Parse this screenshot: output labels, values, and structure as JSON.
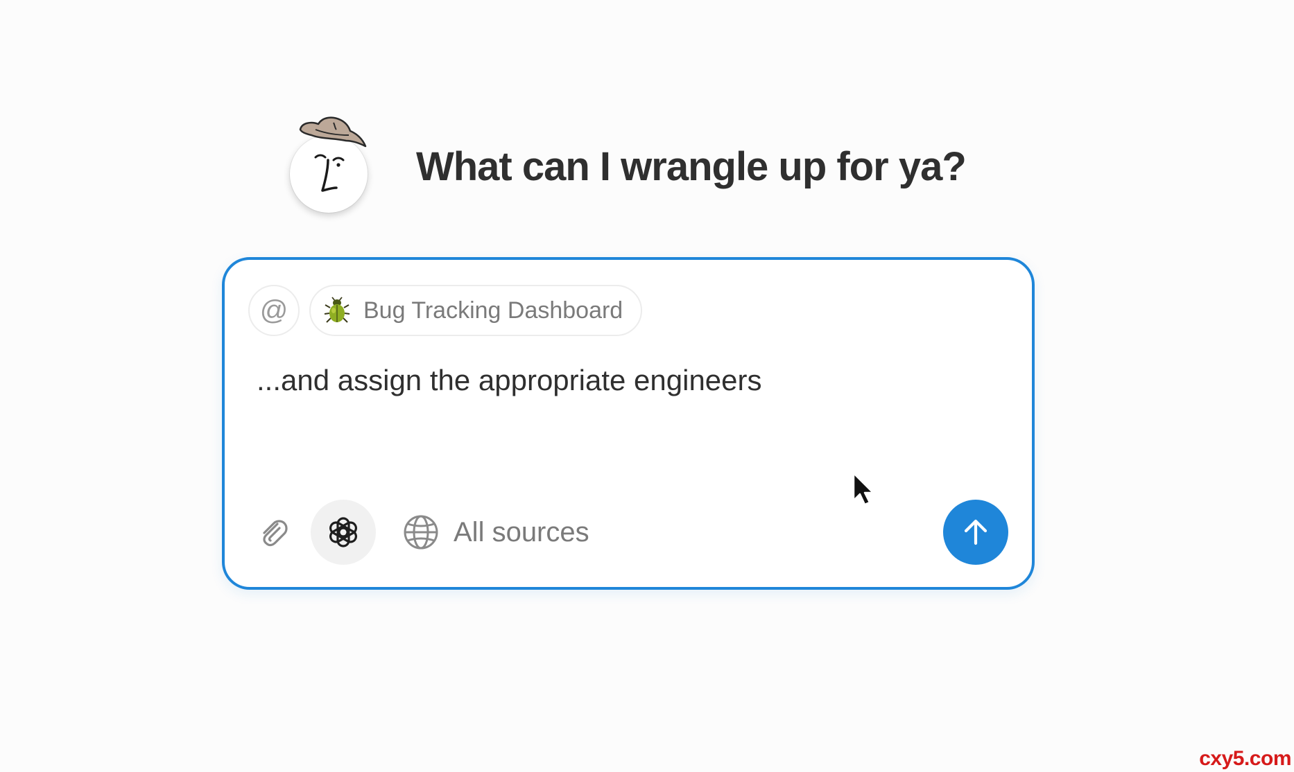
{
  "greeting": {
    "title": "What can I wrangle up for ya?",
    "avatar_icon": "cowboy-face-avatar"
  },
  "composer": {
    "accent_color": "#1f86d9",
    "mention_symbol": "@",
    "context_chip": {
      "icon": "beetle-icon",
      "label": "Bug Tracking Dashboard"
    },
    "prompt_text": "...and assign the appropriate engineers",
    "toolbar": {
      "attach_icon": "paperclip-icon",
      "model_icon": "openai-logo-icon",
      "sources_icon": "globe-icon",
      "sources_label": "All sources",
      "send_icon": "arrow-up-icon"
    }
  },
  "watermark": "cxy5.com"
}
